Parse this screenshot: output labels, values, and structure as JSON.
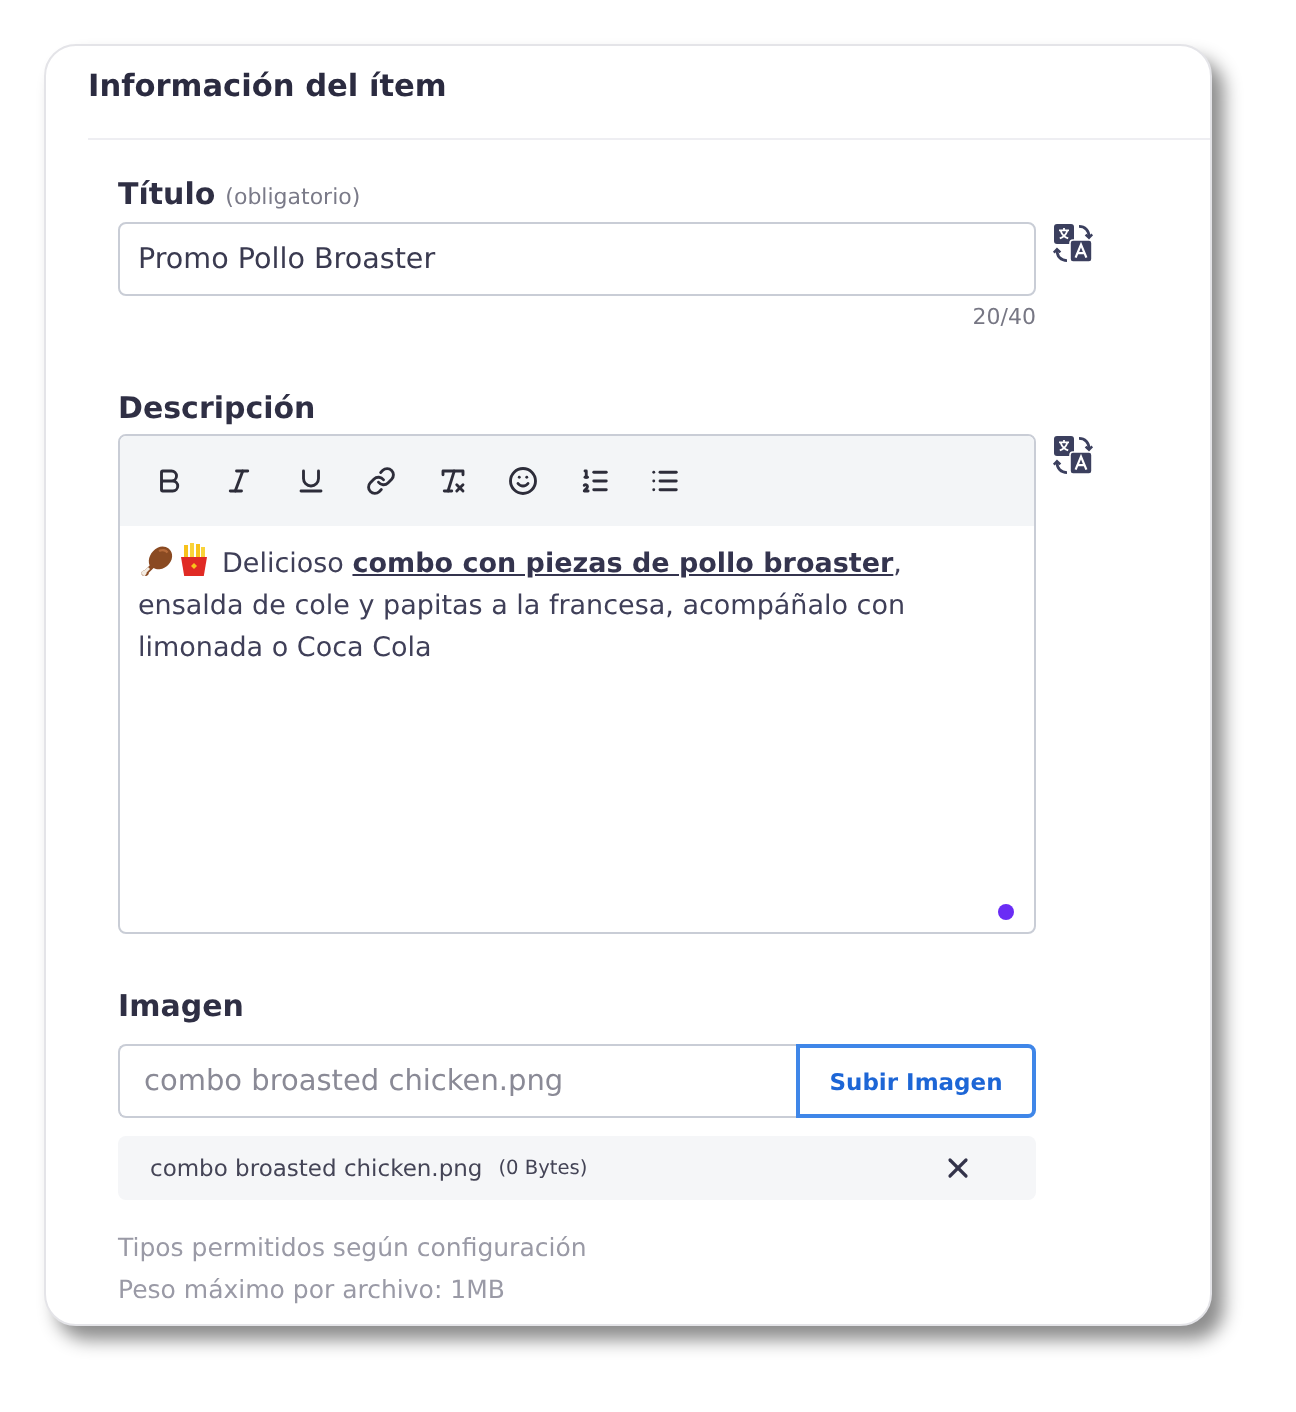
{
  "section": {
    "title": "Información del ítem"
  },
  "title_field": {
    "label": "Título",
    "note": "(obligatorio)",
    "value": "Promo Pollo Broaster",
    "counter": "20/40"
  },
  "description_field": {
    "label": "Descripción",
    "value": "Delicioso **combo con piezas de pollo broaster**, ensalda de cole y papitas a la francesa, acompáñalo con limonada o Coca Cola"
  },
  "image_field": {
    "label": "Imagen",
    "value": "combo broasted chicken.png",
    "upload_button": "Subir Imagen",
    "files": [
      {
        "name": "combo broasted chicken.png",
        "size": "(0 Bytes)"
      }
    ],
    "help": [
      "Tipos permitidos según configuración",
      "Peso máximo por archivo: 1MB"
    ]
  }
}
